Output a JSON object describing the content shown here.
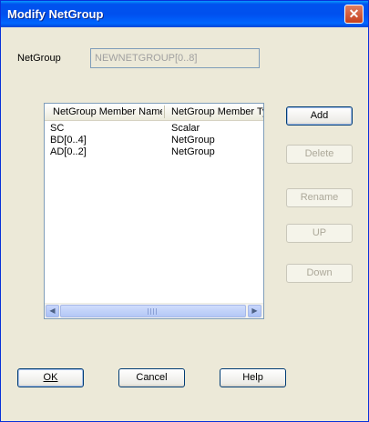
{
  "window": {
    "title": "Modify NetGroup",
    "close_glyph": "✕"
  },
  "form": {
    "netgroup_label": "NetGroup",
    "netgroup_value": "NEWNETGROUP[0..8]"
  },
  "list": {
    "columns": [
      "NetGroup Member Name",
      "NetGroup Member Type"
    ],
    "rows": [
      {
        "name": "SC",
        "type": "Scalar"
      },
      {
        "name": "BD[0..4]",
        "type": "NetGroup"
      },
      {
        "name": "AD[0..2]",
        "type": "NetGroup"
      }
    ],
    "scroll_left_glyph": "◀",
    "scroll_right_glyph": "▶"
  },
  "side_buttons": {
    "add": "Add",
    "delete": "Delete",
    "rename": "Rename",
    "up": "UP",
    "down": "Down"
  },
  "bottom_buttons": {
    "ok": "OK",
    "cancel": "Cancel",
    "help": "Help"
  },
  "colors": {
    "titlebar": "#0053ee",
    "face": "#ece9d8",
    "border": "#003c74"
  }
}
